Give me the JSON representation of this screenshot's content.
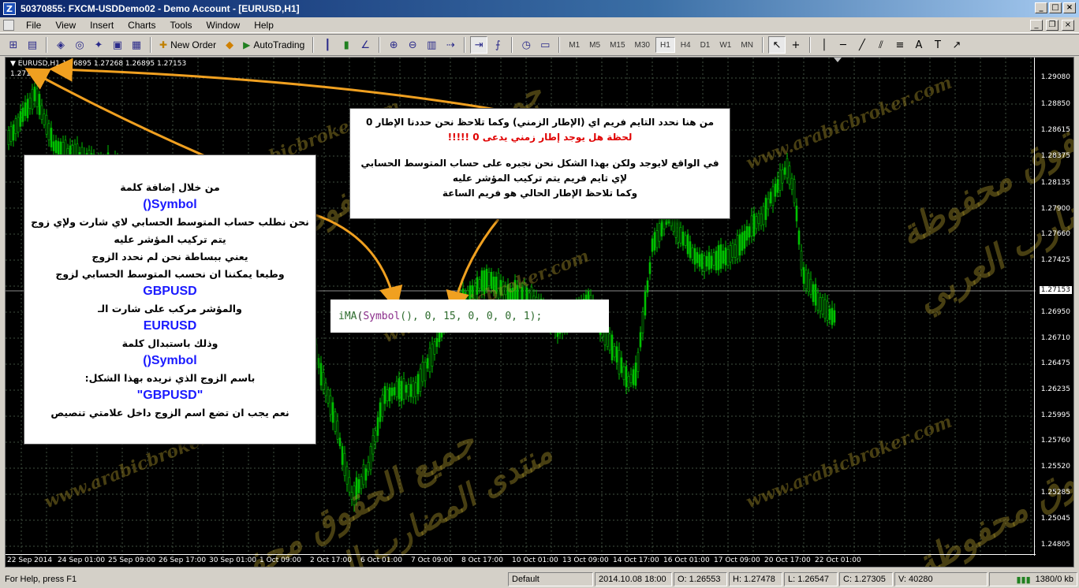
{
  "window": {
    "title": "50370855: FXCM-USDDemo02 - Demo Account - [EURUSD,H1]",
    "app_icon": "Z"
  },
  "menu": [
    "File",
    "View",
    "Insert",
    "Charts",
    "Tools",
    "Window",
    "Help"
  ],
  "toolbar": {
    "new_order": "New Order",
    "autotrading": "AutoTrading",
    "timeframes": [
      "M1",
      "M5",
      "M15",
      "M30",
      "H1",
      "H4",
      "D1",
      "W1",
      "MN"
    ],
    "active_timeframe": "H1"
  },
  "chart": {
    "symbol_label": "EURUSD,H1  1.26895 1.27268 1.26895 1.27153",
    "indicator_value": "1.27124",
    "current_price": "1.27153",
    "price_labels": [
      "1.29080",
      "1.28850",
      "1.28615",
      "1.28375",
      "1.28135",
      "1.27900",
      "1.27660",
      "1.27425",
      "1.27153",
      "1.26950",
      "1.26710",
      "1.26475",
      "1.26235",
      "1.25995",
      "1.25760",
      "1.25520",
      "1.25285",
      "1.25045",
      "1.24805"
    ],
    "time_labels": [
      "22 Sep 2014",
      "24 Sep 01:00",
      "25 Sep 09:00",
      "26 Sep 17:00",
      "30 Sep 01:00",
      "1 Oct 09:00",
      "2 Oct 17:00",
      "6 Oct 01:00",
      "7 Oct 09:00",
      "8 Oct 17:00",
      "10 Oct 01:00",
      "13 Oct 09:00",
      "14 Oct 17:00",
      "16 Oct 01:00",
      "17 Oct 09:00",
      "20 Oct 17:00",
      "22 Oct 01:00"
    ],
    "candle_color": "#00c000",
    "grid_color": "#405040"
  },
  "watermarks": {
    "url": "www.arabicbroker.com",
    "rights": "جميع الحقوق محفوظة",
    "forum": "منتدى المضارب العربي"
  },
  "callout_left": {
    "line1": "من خلال إضافة كلمة",
    "kw1": "Symbol()",
    "line2": "نحن نطلب حساب المتوسط الحسابي لاي شارت ولإي زوج",
    "line3": "يتم تركيب المؤشر عليه",
    "line4": "يعني ببساطة نحن لم نحدد الزوج",
    "line5": "وطبعا يمكننا ان نحسب المتوسط الحسابي لزوج",
    "kw2": "GBPUSD",
    "line6": "والمؤشر مركب على شارت الـ",
    "kw3": "EURUSD",
    "line7": "وذلك باستبدال كلمة",
    "kw4": "Symbol()",
    "line8": "باسم الزوج الذي نريده بهذا الشكل:",
    "kw5": "\"GBPUSD\"",
    "line9": "نعم يجب ان تضع اسم الزوج داخل علامتي تنصيص"
  },
  "callout_right": {
    "line1": "من هنا نحدد التايم فريم اي (الإطار الزمني) وكما تلاحظ نحن حددنا الإطار 0",
    "line2": "لحظة هل يوجد إطار زمني يدعى 0 !!!!!",
    "line3": "في الواقع لايوجد ولكن بهذا الشكل نحن نجبره على حساب المتوسط الحسابي",
    "line4": "لإي تايم فريم يتم تركيب المؤشر عليه",
    "line5": "وكما تلاحظ الإطار الحالي هو فريم الساعة"
  },
  "code": {
    "fn": "iMA",
    "open": "(",
    "sym": "Symbol",
    "rest": "(), 0, 15, 0, 0, 0, 1);"
  },
  "status": {
    "help": "For Help, press F1",
    "profile": "Default",
    "datetime": "2014.10.08 18:00",
    "open": "O: 1.26553",
    "high": "H: 1.27478",
    "low": "L: 1.26547",
    "close": "C: 1.27305",
    "volume": "V: 40280",
    "traffic": "1380/0 kb"
  }
}
